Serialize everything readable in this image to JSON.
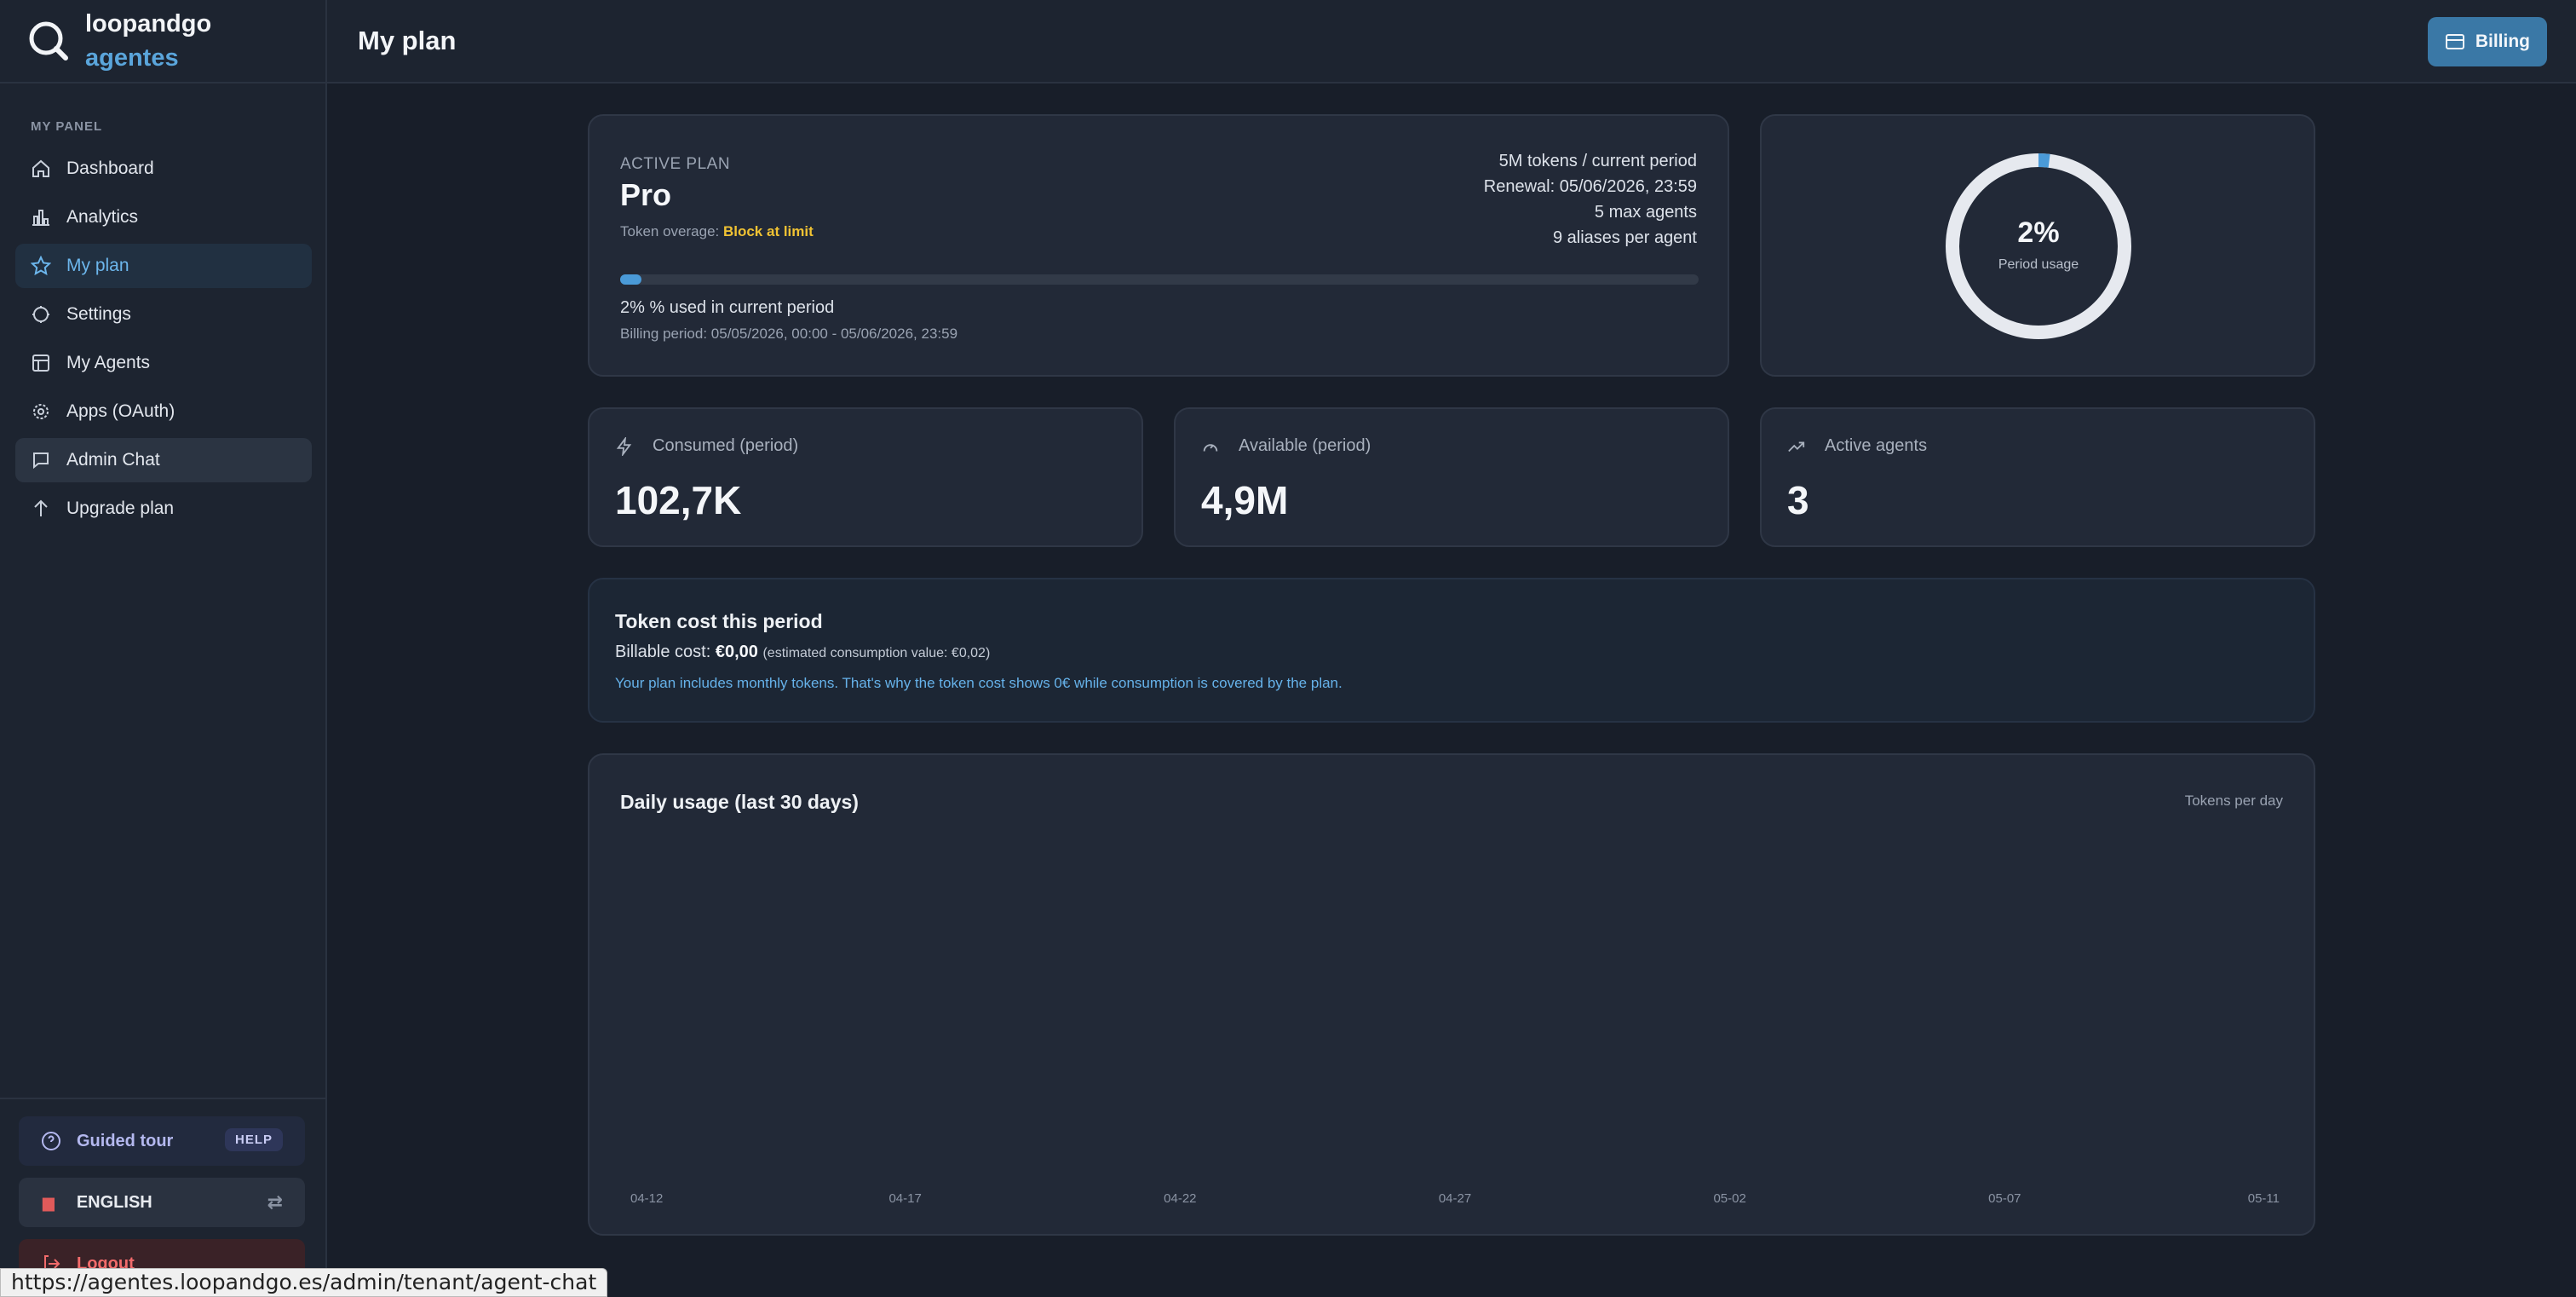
{
  "brand": {
    "name": "loopandgo",
    "sub": "agentes"
  },
  "sidebar": {
    "section_label": "MY PANEL",
    "items": [
      {
        "label": "Dashboard",
        "icon": "home-icon"
      },
      {
        "label": "Analytics",
        "icon": "bar-chart-icon"
      },
      {
        "label": "My plan",
        "icon": "star-icon"
      },
      {
        "label": "Settings",
        "icon": "gear-icon"
      },
      {
        "label": "My Agents",
        "icon": "table-icon"
      },
      {
        "label": "Apps (OAuth)",
        "icon": "cog-icon"
      },
      {
        "label": "Admin Chat",
        "icon": "chat-icon"
      },
      {
        "label": "Upgrade plan",
        "icon": "arrow-up-icon"
      }
    ],
    "active_index": 2,
    "footer": {
      "tour_label": "Guided tour",
      "help_badge": "HELP",
      "language_label": "ENGLISH",
      "logout_label": "Logout"
    }
  },
  "status_url": "https://agentes.loopandgo.es/admin/tenant/agent-chat",
  "header": {
    "title": "My plan",
    "billing_label": "Billing"
  },
  "plan": {
    "label": "ACTIVE PLAN",
    "name": "Pro",
    "overage_prefix": "Token overage: ",
    "overage_value": "Block at limit",
    "details": [
      "5M tokens / current period",
      "Renewal: 05/06/2026, 23:59",
      "5 max agents",
      "9 aliases per agent"
    ],
    "used_fraction": 0.02,
    "used_text": "2% % used in current period",
    "billing_period": "Billing period: 05/05/2026, 00:00 - 05/06/2026, 23:59"
  },
  "usage_donut": {
    "value_text": "2%",
    "label": "Period usage",
    "fraction": 0.02
  },
  "stats": [
    {
      "label": "Consumed (period)",
      "value": "102,7K",
      "icon": "lightning-icon"
    },
    {
      "label": "Available (period)",
      "value": "4,9M",
      "icon": "gauge-icon"
    },
    {
      "label": "Active agents",
      "value": "3",
      "icon": "trending-up-icon"
    }
  ],
  "cost": {
    "title": "Token cost this period",
    "prefix": "Billable cost: ",
    "value": "€0,00",
    "estimate": "(estimated consumption value: €0,02)",
    "note": "Your plan includes monthly tokens. That's why the token cost shows 0€ while consumption is covered by the plan."
  },
  "chart_data": {
    "type": "bar",
    "title": "Daily usage (last 30 days)",
    "ylabel": "Tokens per day",
    "x_ticks": [
      "04-12",
      "04-17",
      "04-22",
      "04-27",
      "05-02",
      "05-07",
      "05-11"
    ],
    "values": []
  }
}
